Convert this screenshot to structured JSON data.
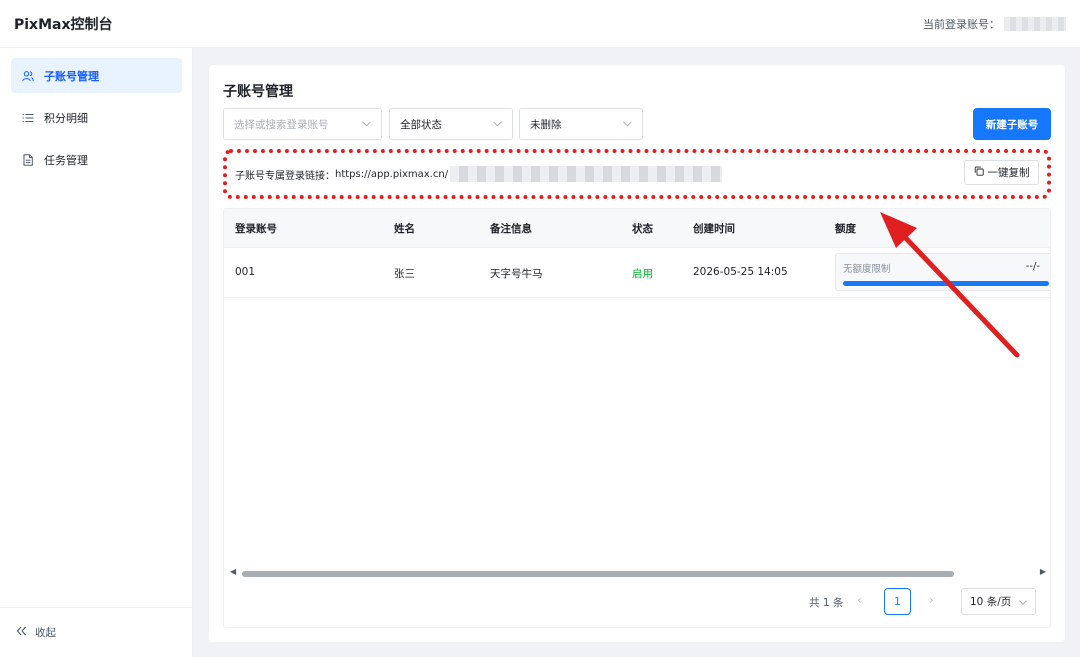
{
  "header": {
    "brand": "PixMax控制台",
    "account_label": "当前登录账号："
  },
  "sidebar": {
    "items": [
      {
        "label": "子账号管理",
        "icon": "users-icon",
        "active": true
      },
      {
        "label": "积分明细",
        "icon": "list-icon",
        "active": false
      },
      {
        "label": "任务管理",
        "icon": "document-icon",
        "active": false
      }
    ],
    "collapse_label": "收起"
  },
  "main": {
    "title": "子账号管理",
    "filters": {
      "account_placeholder": "选择或搜索登录账号",
      "status_value": "全部状态",
      "deleted_value": "未删除"
    },
    "new_button": "新建子账号",
    "link": {
      "label": "子账号专属登录链接：",
      "url_prefix": "https://app.pixmax.cn/",
      "copy_button": "一键复制"
    },
    "table": {
      "columns": [
        "登录账号",
        "姓名",
        "备注信息",
        "状态",
        "创建时间",
        "额度"
      ],
      "rows": [
        {
          "account": "001",
          "name": "张三",
          "note": "天字号牛马",
          "status": "启用",
          "created": "2026-05-25 14:05",
          "quota_label": "无额度限制",
          "quota_value": "--/-",
          "quota_fraction": 1.0
        }
      ]
    },
    "pagination": {
      "total": "共 1 条",
      "current_page": "1",
      "page_size": "10 条/页"
    }
  },
  "colors": {
    "primary": "#1677ff",
    "active_bg": "#e8f3ff",
    "success": "#00b42a",
    "highlight_red": "#e02020"
  }
}
